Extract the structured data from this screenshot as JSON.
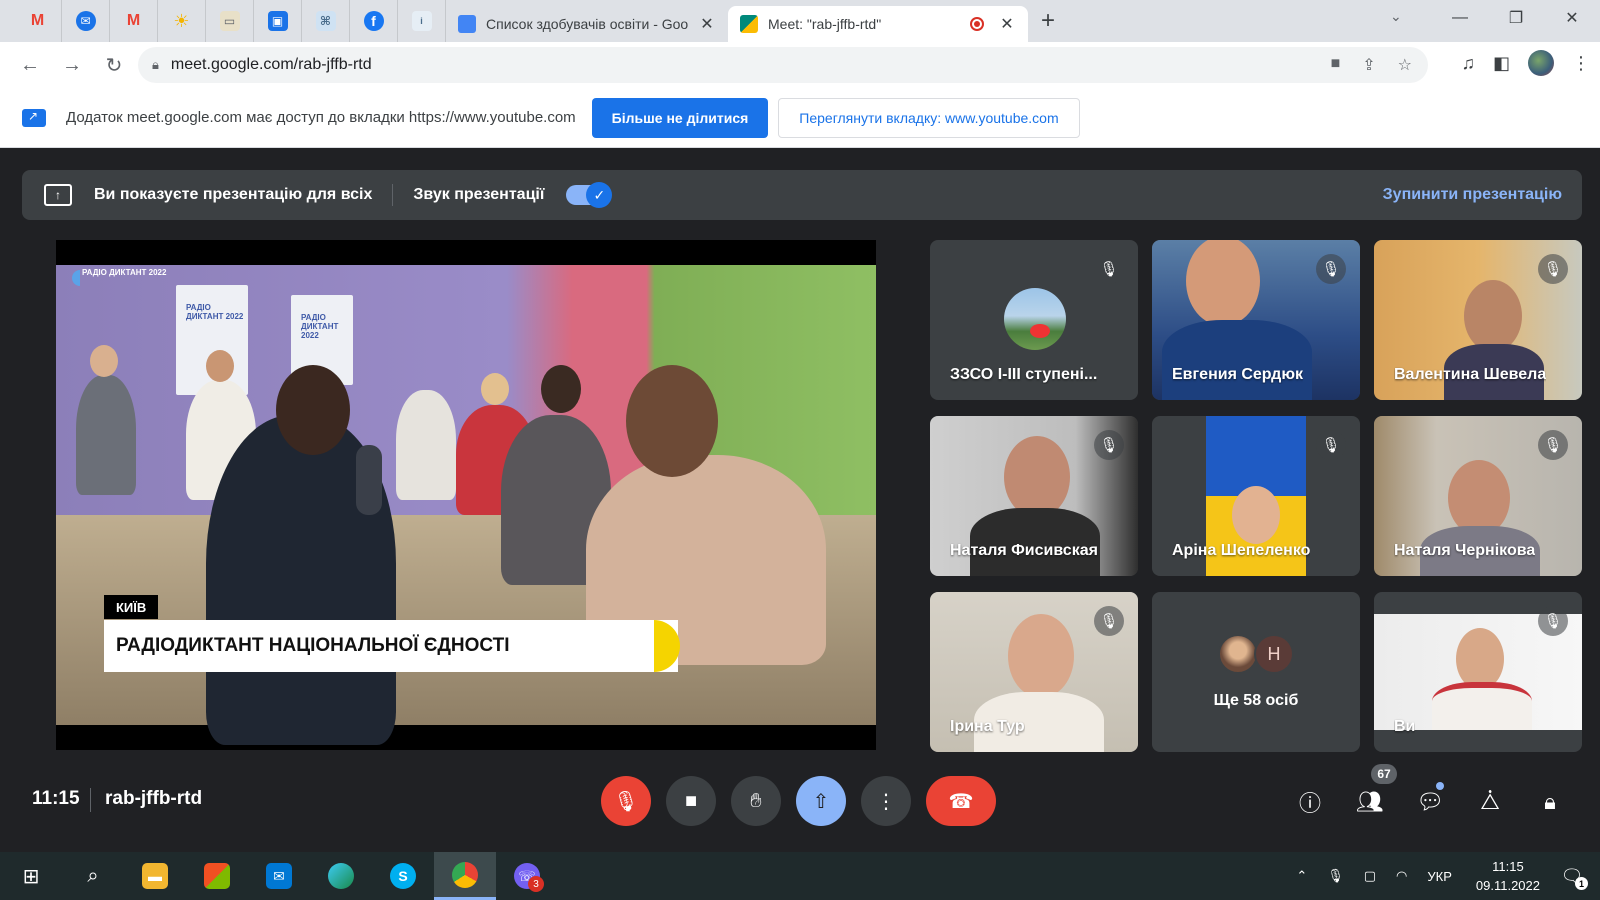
{
  "browser": {
    "pinned_tabs": [
      {
        "icon": "gmail-icon",
        "glyph": "M",
        "color": "#ea4335"
      },
      {
        "icon": "messenger-icon",
        "glyph": "✉",
        "color": "#1a73e8"
      },
      {
        "icon": "gmail-icon",
        "glyph": "M",
        "color": "#ea4335"
      },
      {
        "icon": "sun-icon",
        "glyph": "☀",
        "color": "#f4b400"
      },
      {
        "icon": "tablet-icon",
        "glyph": "▭",
        "color": "#7a8a9a"
      },
      {
        "icon": "screen-icon",
        "glyph": "▣",
        "color": "#1a73e8"
      },
      {
        "icon": "map-icon",
        "glyph": "⌘",
        "color": "#8ab4d8"
      },
      {
        "icon": "facebook-icon",
        "glyph": "f",
        "color": "#1877f2"
      },
      {
        "icon": "imzo-icon",
        "glyph": "i",
        "color": "#4a6d8c"
      }
    ],
    "tabs": [
      {
        "title": "Список здобувачів освіти - Goo",
        "close": "✕",
        "color": "#4285f4"
      },
      {
        "title": "Meet: \"rab-jffb-rtd\"",
        "close": "✕",
        "color": "#00897b"
      }
    ],
    "new_tab": "+",
    "url": "meet.google.com/rab-jffb-rtd",
    "infobar": {
      "message": "Додаток meet.google.com має доступ до вкладки https://www.youtube.com",
      "stop_sharing": "Більше не ділитися",
      "view_tab": "Переглянути вкладку: www.youtube.com"
    }
  },
  "meet": {
    "presenting_text": "Ви показуєте презентацію для всіх",
    "presentation_audio": "Звук презентації",
    "presentation_audio_on": true,
    "stop_presentation": "Зупинити презентацію",
    "video": {
      "city": "КИЇВ",
      "title": "РАДІОДИКТАНТ НАЦІОНАЛЬНОЇ ЄДНОСТІ",
      "logo": "РАДІО ДИКТАНТ 2022",
      "banner": "РАДІО ДИКТАНТ 2022"
    },
    "participants": [
      {
        "name": "ЗЗСО І-ІІІ ступені...",
        "muted": true
      },
      {
        "name": "Евгения Сердюк",
        "muted": true
      },
      {
        "name": "Валентина Шевела",
        "muted": true
      },
      {
        "name": "Наталя Фисивская",
        "muted": true
      },
      {
        "name": "Аріна Шепеленко",
        "muted": true
      },
      {
        "name": "Наталя Чернікова",
        "muted": true
      },
      {
        "name": "Ірина Тур",
        "muted": true
      },
      {
        "name": "Ще 58 осіб",
        "initial": "Н"
      },
      {
        "name": "Ви",
        "muted": true
      }
    ],
    "clock": "11:15",
    "meeting_code": "rab-jffb-rtd",
    "participants_count": "67"
  },
  "taskbar": {
    "viber_badge": "3",
    "language": "УКР",
    "time": "11:15",
    "date": "09.11.2022",
    "notifications": "1"
  }
}
